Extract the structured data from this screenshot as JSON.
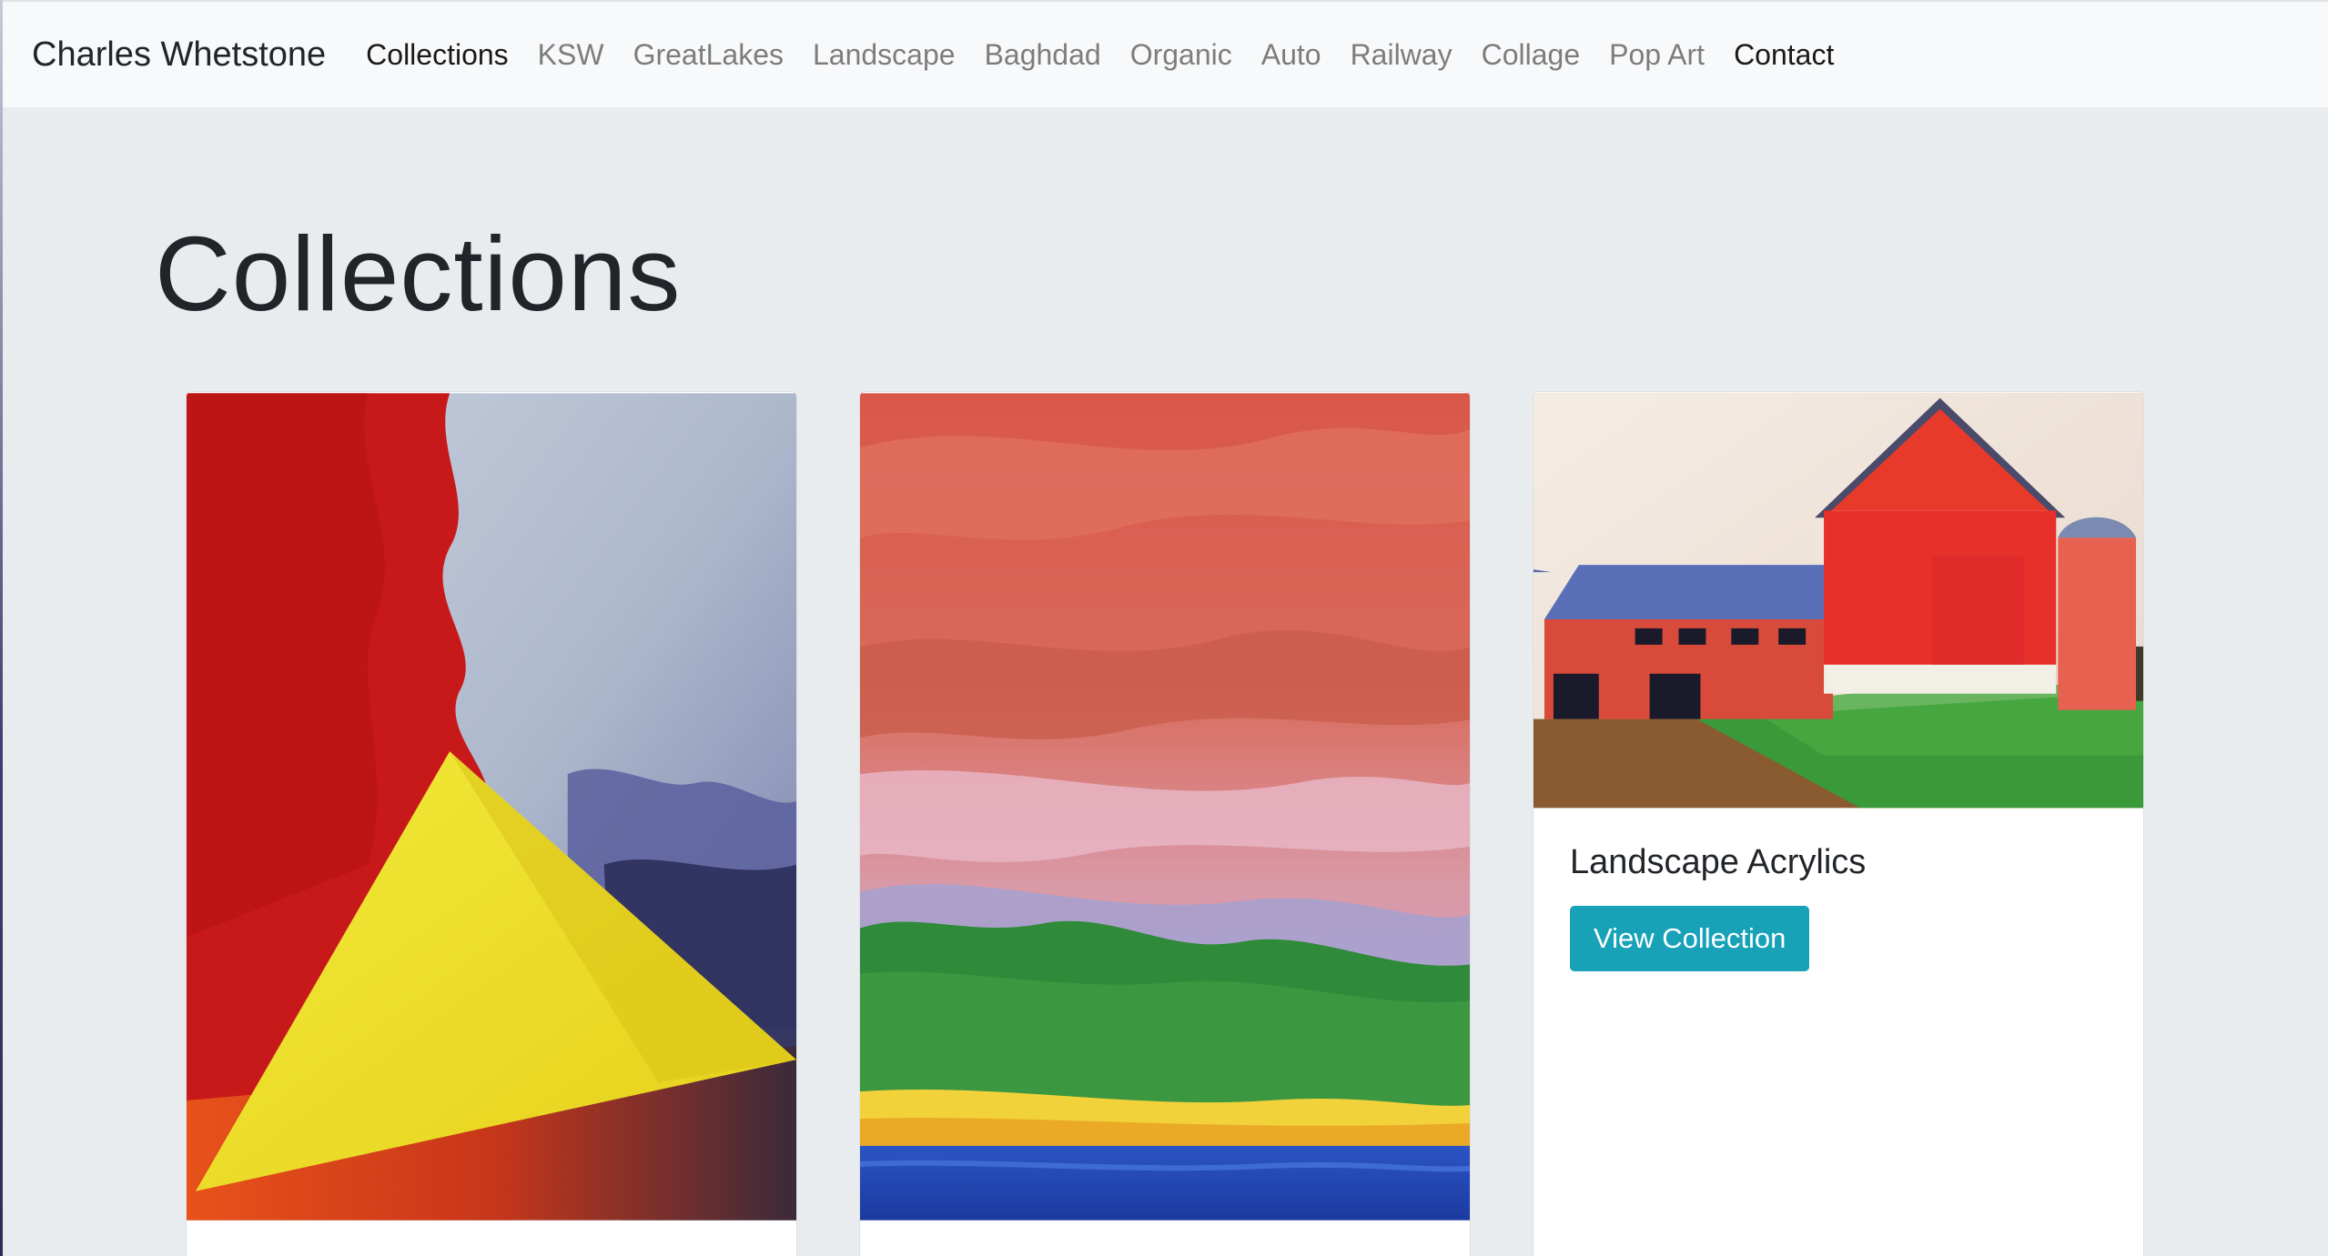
{
  "navbar": {
    "brand": "Charles Whetstone",
    "items": [
      {
        "label": "Collections"
      },
      {
        "label": "KSW"
      },
      {
        "label": "GreatLakes"
      },
      {
        "label": "Landscape"
      },
      {
        "label": "Baghdad"
      },
      {
        "label": "Organic"
      },
      {
        "label": "Auto"
      },
      {
        "label": "Railway"
      },
      {
        "label": "Collage"
      },
      {
        "label": "Pop Art"
      },
      {
        "label": "Contact"
      }
    ]
  },
  "main": {
    "heading": "Collections",
    "cards": [
      {
        "title": "",
        "button": ""
      },
      {
        "title": "",
        "button": ""
      },
      {
        "title": "Landscape Acrylics",
        "button": "View Collection"
      }
    ]
  },
  "colors": {
    "accent": "#17a2b8",
    "page_bg": "#e9ecef",
    "navbar_bg": "#f8f9fa"
  }
}
